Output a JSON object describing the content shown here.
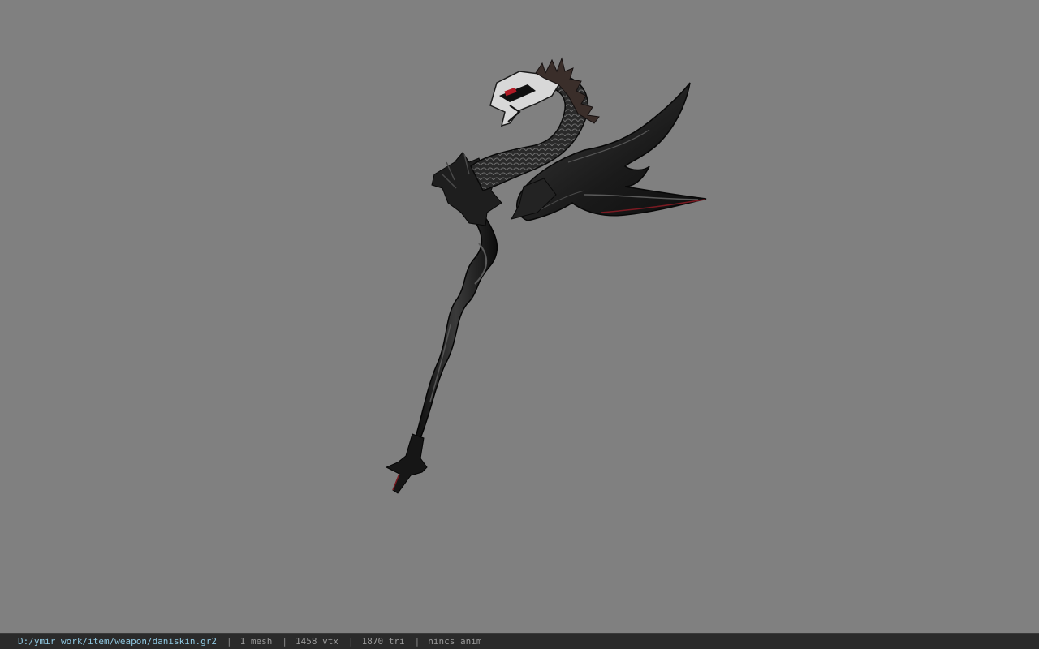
{
  "viewport": {
    "background_color": "#808080",
    "model_description_icon": "scythe-model-icon"
  },
  "status": {
    "file_path": "D:/ymir work/item/weapon/daniskin.gr2",
    "separator": "|",
    "mesh_count": "1 mesh",
    "vertex_count": "1458 vtx",
    "triangle_count": "1870 tri",
    "animation": "nincs anim"
  },
  "colors": {
    "model_dark": "#141414",
    "model_mid": "#2e2e2e",
    "model_highlight": "#6a6a6a",
    "model_accent_red": "#8a1b22",
    "path_text": "#8fc7e0",
    "status_text": "#9a9a9a",
    "statusbar_bg": "#2a2a2a"
  }
}
